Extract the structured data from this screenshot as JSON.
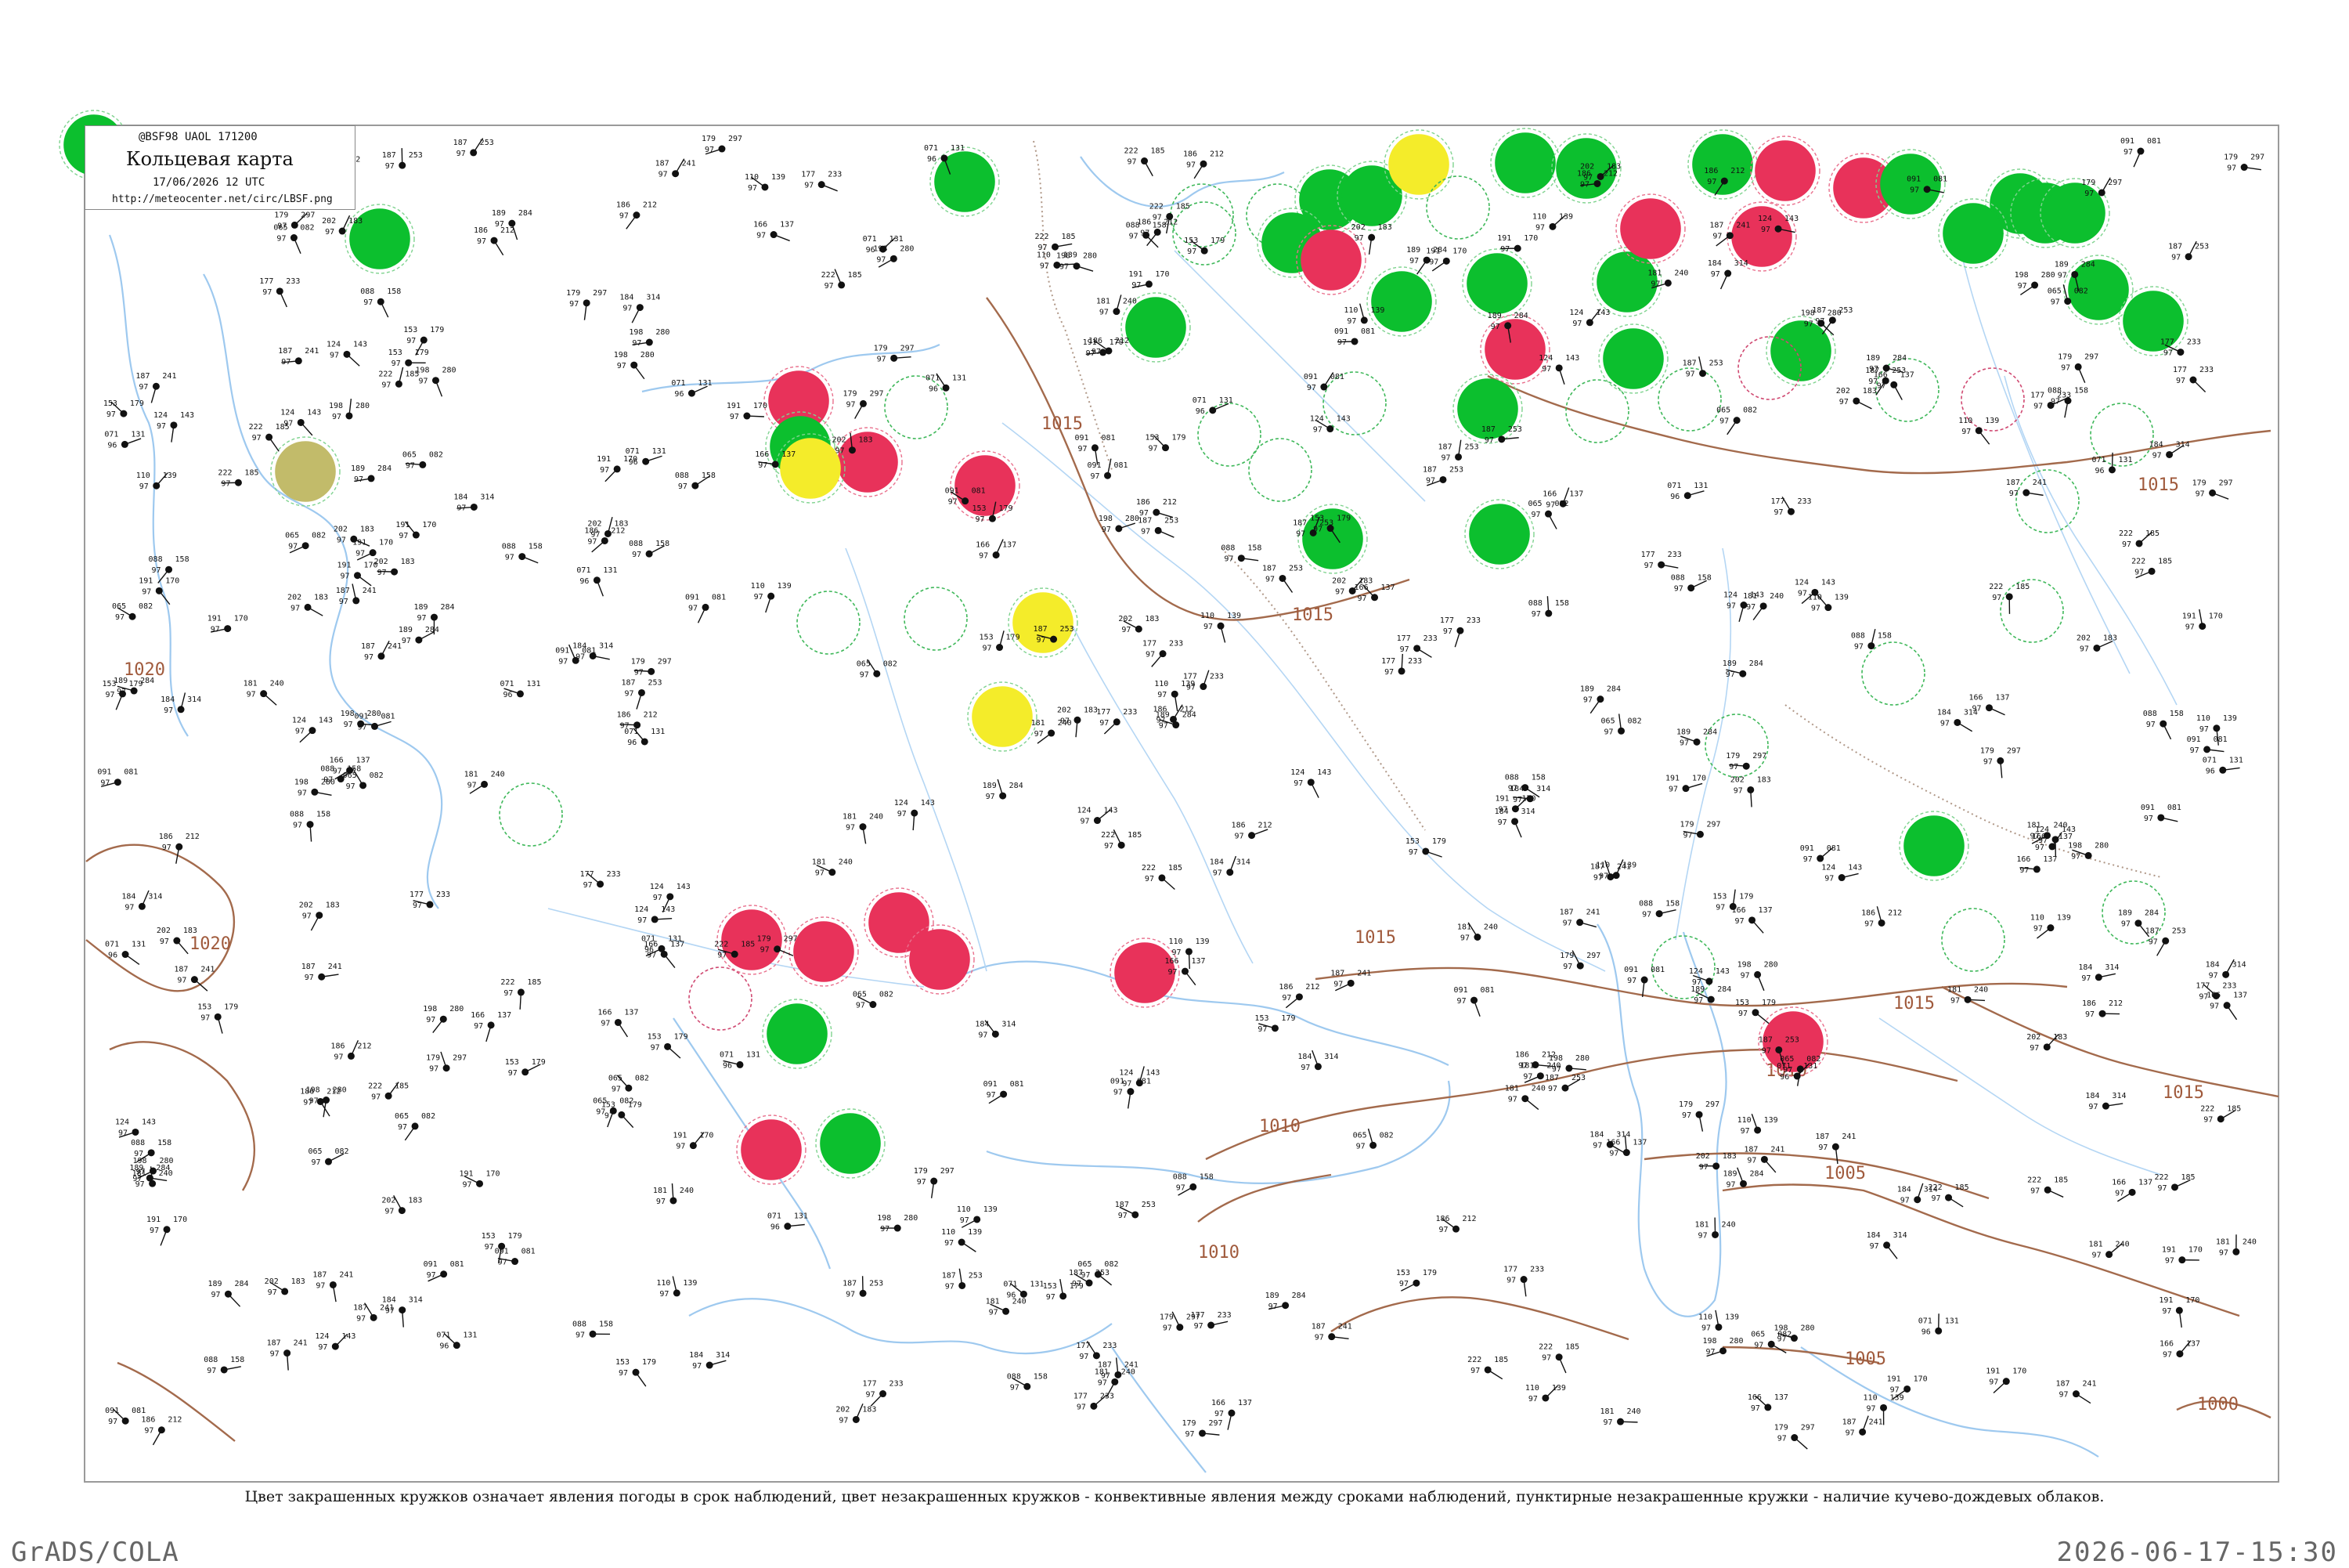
{
  "legend": {
    "code": "@BSF98  UAOL  171200",
    "title": "Кольцевая карта",
    "date": "17/06/2026 12 UTC",
    "url": "http://meteocenter.net/circ/LBSF.png"
  },
  "caption": "Цвет закрашенных кружков означает явления погоды в срок наблюдений, цвет незакрашенных кружков - конвективные явления между сроками наблюдений, пунктирные незакрашенные кружки - наличие кучево-дождевых облаков.",
  "footer": {
    "left": "GrADS/COLA",
    "right": "2026-06-17-15:30"
  },
  "colors": {
    "thunder": "#0cbf2e",
    "rain": "#e8325a",
    "fog": "#f4ec2a",
    "haze": "#c2bb6a",
    "isobar": "#a36a4c",
    "water": "#9ec9ef"
  },
  "isobar_labels": [
    "1020",
    "1020",
    "1015",
    "1015",
    "1015",
    "1015",
    "1015",
    "1015",
    "1010",
    "1010",
    "1010",
    "1005",
    "1005",
    "1000"
  ],
  "stations": [
    {
      "code": "185",
      "t": "222",
      "p": "97"
    },
    {
      "code": "212",
      "t": "186",
      "p": "97"
    },
    {
      "code": "183",
      "t": "202",
      "p": "97"
    },
    {
      "code": "179",
      "t": "153",
      "p": "97"
    },
    {
      "code": "170",
      "t": "191",
      "p": "97"
    },
    {
      "code": "137",
      "t": "166",
      "p": "97"
    },
    {
      "code": "143",
      "t": "124",
      "p": "97"
    },
    {
      "code": "158",
      "t": "088",
      "p": "97"
    },
    {
      "code": "081",
      "t": "091",
      "p": "97"
    },
    {
      "code": "131",
      "t": "071",
      "p": "96"
    },
    {
      "code": "082",
      "t": "065",
      "p": "97"
    },
    {
      "code": "139",
      "t": "110",
      "p": "97"
    },
    {
      "code": "253",
      "t": "187",
      "p": "97"
    },
    {
      "code": "240",
      "t": "181",
      "p": "97"
    },
    {
      "code": "241",
      "t": "187",
      "p": "97"
    },
    {
      "code": "297",
      "t": "179",
      "p": "97"
    },
    {
      "code": "233",
      "t": "177",
      "p": "97"
    },
    {
      "code": "284",
      "t": "189",
      "p": "97"
    },
    {
      "code": "280",
      "t": "198",
      "p": "97"
    },
    {
      "code": "314",
      "t": "184",
      "p": "97"
    }
  ]
}
